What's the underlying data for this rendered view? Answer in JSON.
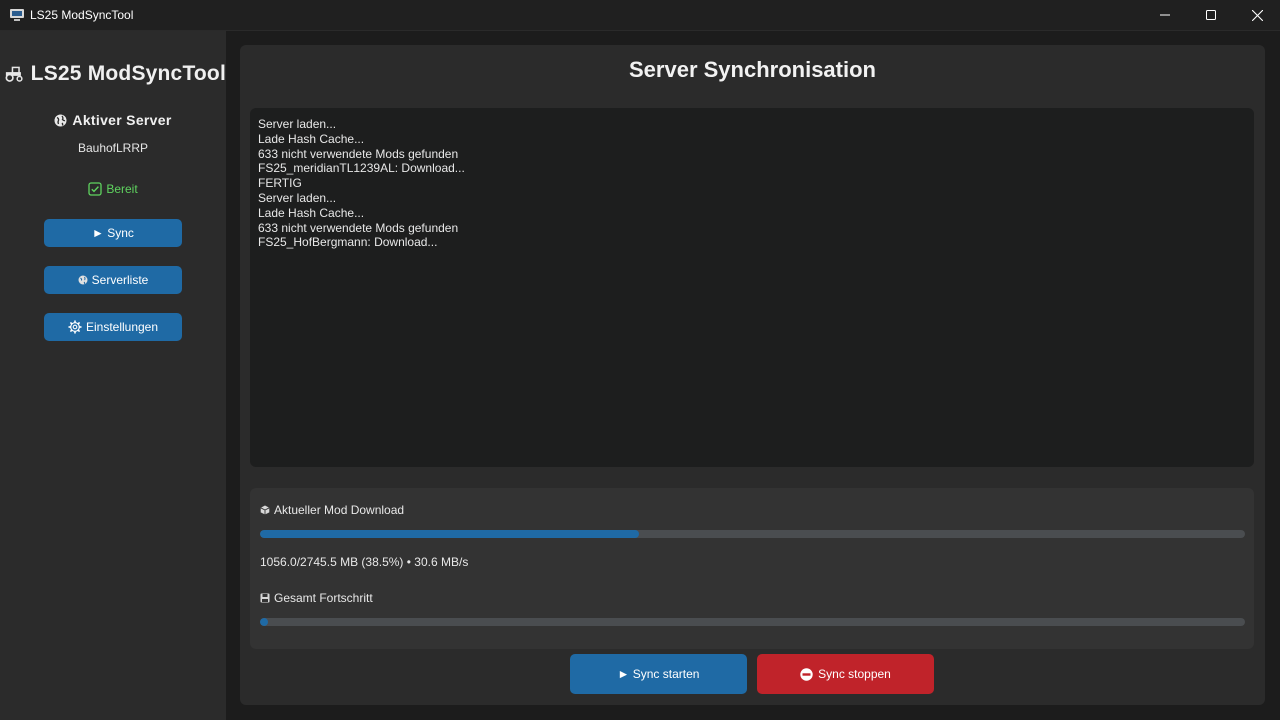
{
  "window": {
    "title": "LS25 ModSyncTool",
    "controls": [
      "minimize-icon",
      "maximize-icon",
      "close-icon"
    ]
  },
  "sidebar": {
    "brand_icon": "tractor-icon",
    "brand_title": "LS25 ModSyncTool",
    "server_icon": "globe-icon",
    "server_heading": "Aktiver Server",
    "server_name": "BauhofLRRP",
    "status_icon": "checkbox-icon",
    "status": "Bereit",
    "status_color": "#5fd35f",
    "nav": [
      {
        "icon": "play-icon",
        "label": "► Sync"
      },
      {
        "icon": "globe-icon",
        "label": "Serverliste"
      },
      {
        "icon": "gear-icon",
        "label": "Einstellungen"
      }
    ]
  },
  "main": {
    "title": "Server Synchronisation",
    "log_lines": [
      "Server laden...",
      "Lade Hash Cache...",
      "633 nicht verwendete Mods gefunden",
      "FS25_meridianTL1239AL: Download...",
      "FERTIG",
      "Server laden...",
      "Lade Hash Cache...",
      "633 nicht verwendete Mods gefunden",
      "FS25_HofBergmann: Download..."
    ],
    "current_download": {
      "icon": "package-icon",
      "label": "Aktueller Mod Download",
      "progress": 0.385,
      "info": "1056.0/2745.5 MB (38.5%) • 30.6 MB/s"
    },
    "total_progress": {
      "icon": "floppy-disk-icon",
      "label": "Gesamt Fortschritt",
      "progress": 0.008
    },
    "buttons": {
      "start": "► Sync starten",
      "stop": "Sync stoppen",
      "stop_icon": "no-entry-icon"
    }
  },
  "colors": {
    "accent": "#1f6aa5",
    "danger": "#c0232a",
    "background": "#1c1c1c",
    "panel": "#2b2b2b"
  }
}
